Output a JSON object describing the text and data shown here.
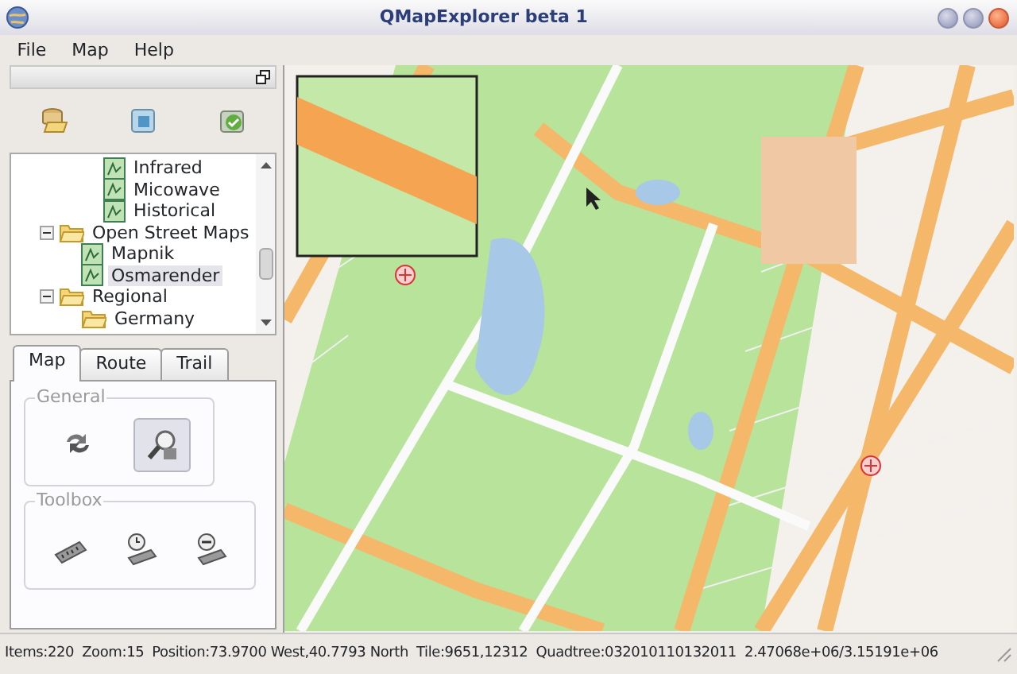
{
  "window": {
    "title": "QMapExplorer beta 1"
  },
  "menu": [
    "File",
    "Map",
    "Help"
  ],
  "tree": {
    "continued_items": [
      {
        "label": "Infrared",
        "kind": "layer",
        "selected": false
      },
      {
        "label": "Micowave",
        "kind": "layer",
        "selected": false
      },
      {
        "label": "Historical",
        "kind": "layer",
        "selected": false
      }
    ],
    "items": [
      {
        "label": "Open Street Maps",
        "kind": "folder",
        "expanded": true,
        "selected": false,
        "children": [
          {
            "label": "Mapnik",
            "kind": "layer",
            "selected": false
          },
          {
            "label": "Osmarender",
            "kind": "layer",
            "selected": true
          }
        ]
      },
      {
        "label": "Regional",
        "kind": "folder",
        "expanded": true,
        "selected": false,
        "children": [
          {
            "label": "Germany",
            "kind": "folder",
            "selected": false
          }
        ]
      }
    ]
  },
  "tabs": [
    {
      "label": "Map",
      "selected": true
    },
    {
      "label": "Route",
      "selected": false
    },
    {
      "label": "Trail",
      "selected": false
    }
  ],
  "groups": [
    {
      "title": "General",
      "tools": [
        {
          "kind": "refresh",
          "pressed": false
        },
        {
          "kind": "magnifier",
          "pressed": true
        }
      ]
    },
    {
      "title": "Toolbox",
      "tools": [
        {
          "kind": "ruler",
          "pressed": false
        },
        {
          "kind": "ruler-clock",
          "pressed": false
        },
        {
          "kind": "ruler-minus",
          "pressed": false
        }
      ]
    }
  ],
  "status_bar": [
    "Items:220",
    "Zoom:15",
    "Position:73.9700 West,40.7793 North",
    "Tile:9651,12312",
    "Quadtree:032010110132011",
    "2.47068e+06/3.15191e+06"
  ]
}
